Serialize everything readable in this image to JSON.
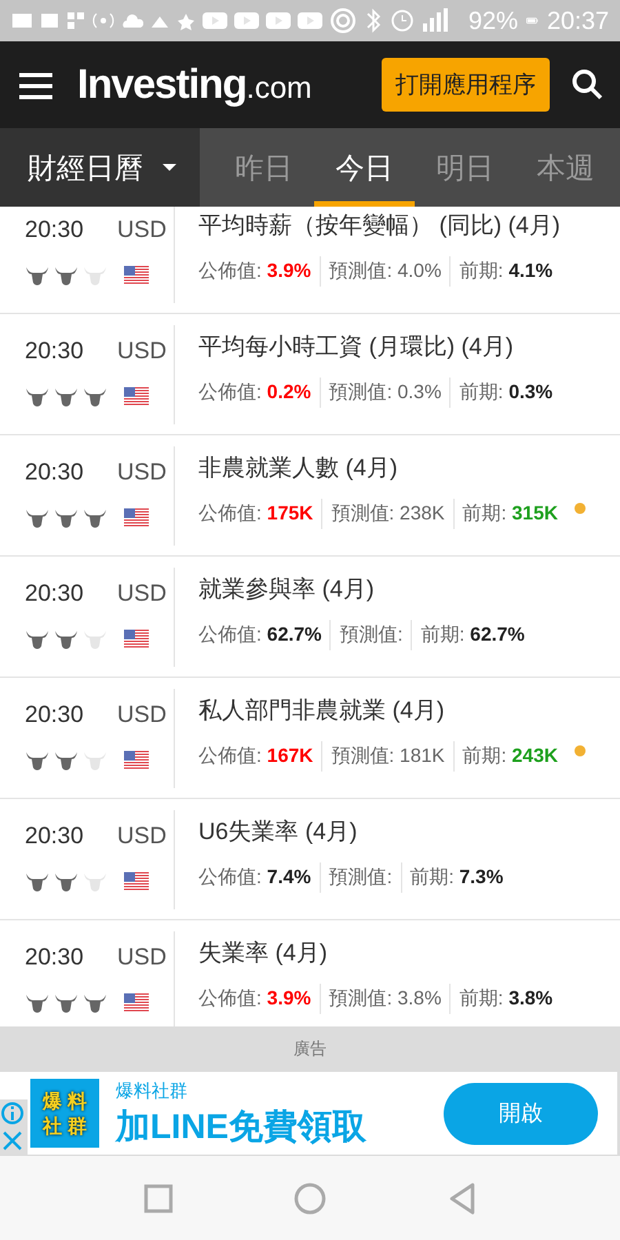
{
  "status_bar": {
    "battery": "92%",
    "time": "20:37"
  },
  "header": {
    "logo_main": "Investing",
    "logo_suffix": ".com",
    "open_app_button": "打開應用程序"
  },
  "calendar_menu": {
    "label": "財經日曆"
  },
  "tabs": [
    {
      "label": "昨日",
      "selected": false
    },
    {
      "label": "今日",
      "selected": true
    },
    {
      "label": "明日",
      "selected": false
    },
    {
      "label": "本週",
      "selected": false
    }
  ],
  "events": [
    {
      "time": "20:30",
      "currency": "USD",
      "stars": 2,
      "title": "平均時薪（按年變幅） (同比) (4月)",
      "actual_label": "公佈值:",
      "actual": {
        "text": "3.9%",
        "color": "#ff0000"
      },
      "forecast_label": "預測值:",
      "forecast": "4.0%",
      "previous_label": "前期:",
      "previous": {
        "text": "4.1%",
        "color": "#222222"
      },
      "revised": false
    },
    {
      "time": "20:30",
      "currency": "USD",
      "stars": 3,
      "title": "平均每小時工資 (月環比) (4月)",
      "actual_label": "公佈值:",
      "actual": {
        "text": "0.2%",
        "color": "#ff0000"
      },
      "forecast_label": "預測值:",
      "forecast": "0.3%",
      "previous_label": "前期:",
      "previous": {
        "text": "0.3%",
        "color": "#222222"
      },
      "revised": false
    },
    {
      "time": "20:30",
      "currency": "USD",
      "stars": 3,
      "title": "非農就業人數 (4月)",
      "actual_label": "公佈值:",
      "actual": {
        "text": "175K",
        "color": "#ff0000"
      },
      "forecast_label": "預測值:",
      "forecast": "238K",
      "previous_label": "前期:",
      "previous": {
        "text": "315K",
        "color": "#1ea01e"
      },
      "revised": true
    },
    {
      "time": "20:30",
      "currency": "USD",
      "stars": 2,
      "title": "就業參與率 (4月)",
      "actual_label": "公佈值:",
      "actual": {
        "text": "62.7%",
        "color": "#222222"
      },
      "forecast_label": "預測值:",
      "previous_label": "前期:",
      "previous": {
        "text": "62.7%",
        "color": "#222222"
      },
      "revised": false
    },
    {
      "time": "20:30",
      "currency": "USD",
      "stars": 2,
      "title": "私人部門非農就業 (4月)",
      "actual_label": "公佈值:",
      "actual": {
        "text": "167K",
        "color": "#ff0000"
      },
      "forecast_label": "預測值:",
      "forecast": "181K",
      "previous_label": "前期:",
      "previous": {
        "text": "243K",
        "color": "#1ea01e"
      },
      "revised": true
    },
    {
      "time": "20:30",
      "currency": "USD",
      "stars": 2,
      "title": "U6失業率 (4月)",
      "actual_label": "公佈值:",
      "actual": {
        "text": "7.4%",
        "color": "#222222"
      },
      "forecast_label": "預測值:",
      "previous_label": "前期:",
      "previous": {
        "text": "7.3%",
        "color": "#222222"
      },
      "revised": false
    },
    {
      "time": "20:30",
      "currency": "USD",
      "stars": 3,
      "title": "失業率 (4月)",
      "actual_label": "公佈值:",
      "actual": {
        "text": "3.9%",
        "color": "#ff0000"
      },
      "forecast_label": "預測值:",
      "forecast": "3.8%",
      "previous_label": "前期:",
      "previous": {
        "text": "3.8%",
        "color": "#222222"
      },
      "revised": false
    }
  ],
  "ad": {
    "label": "廣告",
    "logo_text": "爆料社群",
    "brand": "爆料社群",
    "headline": "加LINE免費領取",
    "button": "開啟"
  }
}
